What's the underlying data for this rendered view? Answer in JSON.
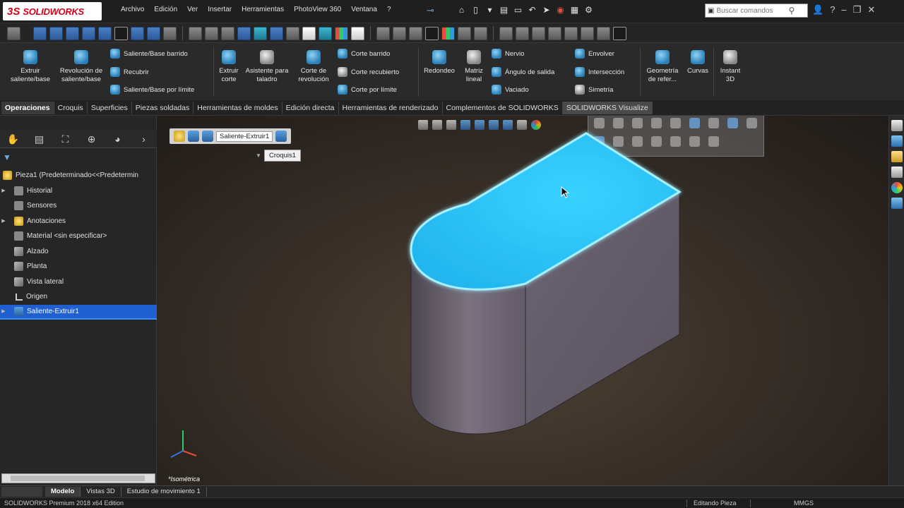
{
  "app": {
    "logo_text": "SOLIDWORKS",
    "logo_mark": "3S"
  },
  "menu": [
    "Archivo",
    "Edición",
    "Ver",
    "Insertar",
    "Herramientas",
    "PhotoView 360",
    "Ventana",
    "?"
  ],
  "search": {
    "placeholder": "Buscar comandos"
  },
  "ribbon": {
    "extruir_saliente": "Extruir saliente/base",
    "revolucion_saliente": "Revolución de saliente/base",
    "saliente_barrido": "Saliente/Base barrido",
    "recubrir": "Recubrir",
    "saliente_limite": "Saliente/Base por límite",
    "extruir_corte": "Extruir corte",
    "asistente_taladro": "Asistente para taladro",
    "corte_revolucion": "Corte de revolución",
    "corte_barrido": "Corte barrido",
    "corte_recubierto": "Corte recubierto",
    "corte_limite": "Corte por límite",
    "redondeo": "Redondeo",
    "matriz_lineal": "Matriz lineal",
    "nervio": "Nervio",
    "angulo_salida": "Ángulo de salida",
    "vaciado": "Vaciado",
    "envolver": "Envolver",
    "interseccion": "Intersección",
    "simetria": "Simetría",
    "geometria_ref": "Geometría de refer...",
    "curvas": "Curvas",
    "instant3d": "Instant 3D"
  },
  "tabs": [
    "Operaciones",
    "Croquis",
    "Superficies",
    "Piezas soldadas",
    "Herramientas de moldes",
    "Edición directa",
    "Herramientas de renderizado",
    "Complementos de SOLIDWORKS",
    "SOLIDWORKS Visualize"
  ],
  "tree": {
    "root": "Pieza1 (Predeterminado<<Predetermin",
    "items": [
      {
        "label": "Historial",
        "icon": "history-icon",
        "expandable": true
      },
      {
        "label": "Sensores",
        "icon": "sensor-icon",
        "expandable": false
      },
      {
        "label": "Anotaciones",
        "icon": "annotation-icon",
        "expandable": true
      },
      {
        "label": "Material <sin especificar>",
        "icon": "material-icon",
        "expandable": false
      },
      {
        "label": "Alzado",
        "icon": "plane-icon",
        "expandable": false
      },
      {
        "label": "Planta",
        "icon": "plane-icon",
        "expandable": false
      },
      {
        "label": "Vista lateral",
        "icon": "plane-icon",
        "expandable": false
      },
      {
        "label": "Origen",
        "icon": "origin-icon",
        "expandable": false
      },
      {
        "label": "Saliente-Extruir1",
        "icon": "extrude-icon",
        "expandable": true,
        "selected": true
      }
    ]
  },
  "viewport": {
    "breadcrumb_feature": "Saliente-Extruir1",
    "breadcrumb_sketch": "Croquis1",
    "view_label": "*Isométrica",
    "highlight_color": "#2fc8f5",
    "body_color": "#6e6672"
  },
  "bottom_tabs": [
    "Modelo",
    "Vistas 3D",
    "Estudio de movimiento 1"
  ],
  "status": {
    "edition": "SOLIDWORKS Premium 2018 x64 Edition",
    "mode": "Editando Pieza",
    "units": "MMGS"
  }
}
